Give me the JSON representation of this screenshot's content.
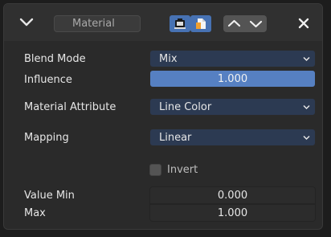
{
  "header": {
    "name_placeholder": "Material",
    "collapse_icon": "chevron-down-icon",
    "render_icon": "camera-icon",
    "viewport_icon": "monitor-icon",
    "move_up_icon": "triangle-up-icon",
    "move_down_icon": "triangle-down-icon",
    "close_icon": "close-icon"
  },
  "properties": {
    "blend_mode": {
      "label": "Blend Mode",
      "value": "Mix"
    },
    "influence": {
      "label": "Influence",
      "value": "1.000"
    },
    "material_attribute": {
      "label": "Material Attribute",
      "value": "Line Color"
    },
    "mapping": {
      "label": "Mapping",
      "value": "Linear"
    },
    "invert": {
      "label": "Invert",
      "checked": false
    },
    "value_min": {
      "label": "Value Min",
      "value": "0.000"
    },
    "max": {
      "label": "Max",
      "value": "1.000"
    }
  },
  "colors": {
    "accent": "#4772b3",
    "slider_fill": "#5680c2",
    "dropdown_bg": "#2c3a52",
    "panel_bg": "#2a2a2a"
  }
}
